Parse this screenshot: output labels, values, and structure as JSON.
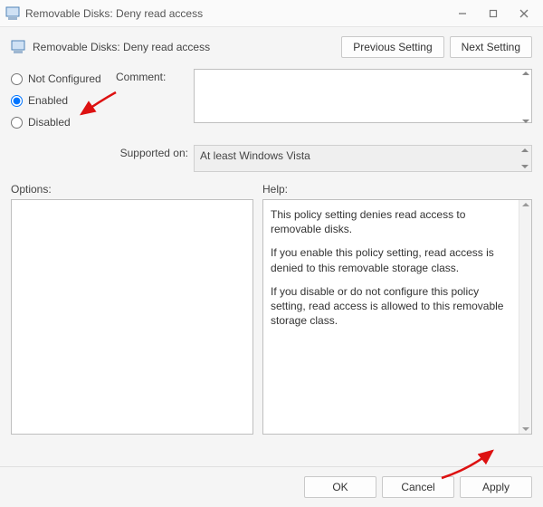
{
  "window": {
    "title": "Removable Disks: Deny read access"
  },
  "header": {
    "policy_title": "Removable Disks: Deny read access",
    "prev": "Previous Setting",
    "next": "Next Setting"
  },
  "state": {
    "not_configured": "Not Configured",
    "enabled": "Enabled",
    "disabled": "Disabled",
    "selected": "enabled"
  },
  "labels": {
    "comment": "Comment:",
    "supported_on": "Supported on:",
    "options": "Options:",
    "help": "Help:"
  },
  "supported_on": {
    "value": "At least Windows Vista"
  },
  "help": {
    "p1": "This policy setting denies read access to removable disks.",
    "p2": "If you enable this policy setting, read access is denied to this removable storage class.",
    "p3": "If you disable or do not configure this policy setting, read access is allowed to this removable storage class."
  },
  "footer": {
    "ok": "OK",
    "cancel": "Cancel",
    "apply": "Apply"
  }
}
